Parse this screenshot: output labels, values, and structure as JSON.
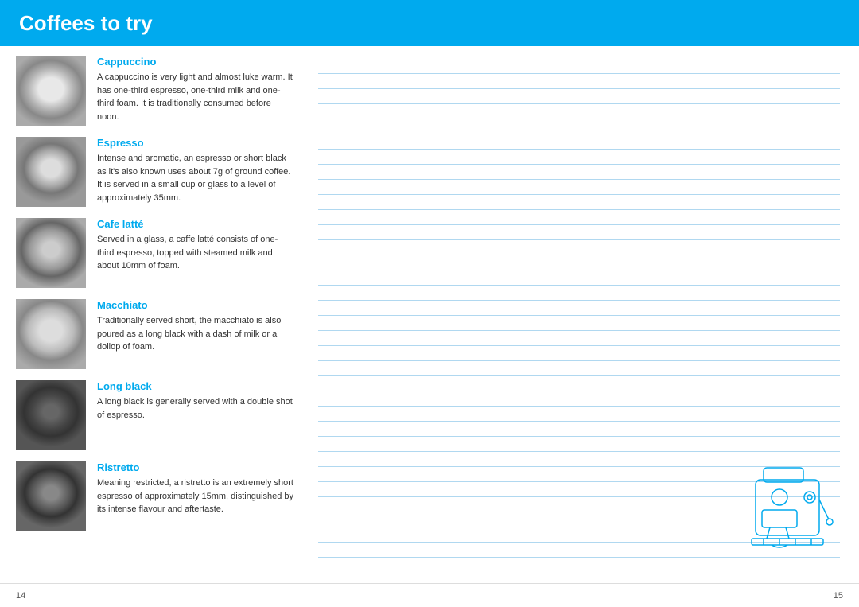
{
  "header": {
    "title": "Coffees to try"
  },
  "coffees": [
    {
      "id": "cappuccino",
      "name": "Cappuccino",
      "description": "A cappuccino is very light and almost luke warm. It has one-third espresso, one-third milk and one-third foam. It is traditionally consumed before noon.",
      "imageClass": "cappuccino"
    },
    {
      "id": "espresso",
      "name": "Espresso",
      "description": "Intense and aromatic, an espresso or short black as it's also known uses about 7g of ground coffee. It is served in a small cup or glass to a level of approximately 35mm.",
      "imageClass": "espresso"
    },
    {
      "id": "latte",
      "name": "Cafe latté",
      "description": "Served in a glass, a caffe latté consists of one-third espresso, topped with steamed milk and about 10mm of foam.",
      "imageClass": "latte"
    },
    {
      "id": "macchiato",
      "name": "Macchiato",
      "description": "Traditionally served short, the macchiato is also poured as a long black with a dash of milk or a dollop of foam.",
      "imageClass": "macchiato"
    },
    {
      "id": "longblack",
      "name": "Long black",
      "description": "A long black is generally served with a double shot of espresso.",
      "imageClass": "longblack"
    },
    {
      "id": "ristretto",
      "name": "Ristretto",
      "description": "Meaning restricted, a ristretto is an extremely short espresso of approximately 15mm, distinguished by its intense flavour and aftertaste.",
      "imageClass": "ristretto"
    }
  ],
  "footer": {
    "left_page": "14",
    "right_page": "15"
  },
  "lines_count": 33
}
